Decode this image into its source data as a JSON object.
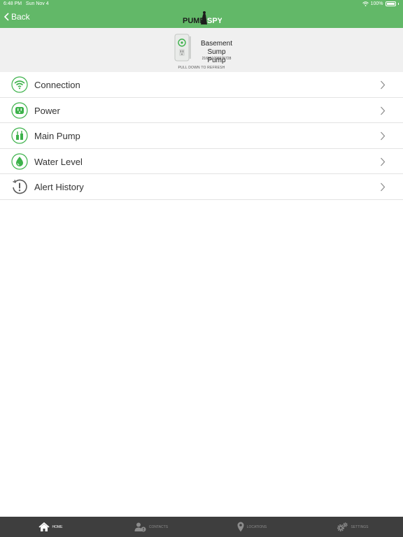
{
  "status_bar": {
    "time": "6:48 PM",
    "date": "Sun Nov 4",
    "battery": "100%"
  },
  "nav": {
    "back_label": "Back",
    "logo_text_left": "PUMP",
    "logo_text_right": "SPY"
  },
  "device": {
    "name_line1": "Basement",
    "name_line2": "Sump Pump",
    "serial": "216051098975728",
    "pull_hint": "PULL DOWN TO REFRESH"
  },
  "menu": {
    "items": [
      {
        "label": "Connection",
        "icon": "wifi-icon"
      },
      {
        "label": "Power",
        "icon": "outlet-icon"
      },
      {
        "label": "Main Pump",
        "icon": "pump-icon"
      },
      {
        "label": "Water Level",
        "icon": "water-drop-icon"
      },
      {
        "label": "Alert History",
        "icon": "alert-history-icon"
      }
    ]
  },
  "tabs": [
    {
      "label": "HOME",
      "icon": "home-icon",
      "active": true
    },
    {
      "label": "CONTACTS",
      "icon": "contacts-icon",
      "active": false
    },
    {
      "label": "LOCATIONS",
      "icon": "location-pin-icon",
      "active": false
    },
    {
      "label": "SETTINGS",
      "icon": "gears-icon",
      "active": false
    }
  ],
  "colors": {
    "brand_green": "#62b868",
    "icon_green": "#3db24b",
    "tab_bar": "#3e3e3e"
  }
}
